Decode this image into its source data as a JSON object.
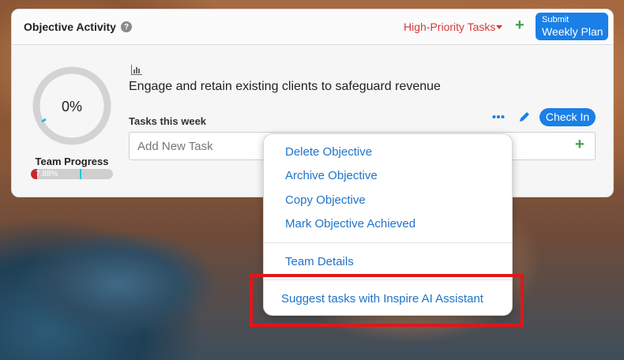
{
  "header": {
    "title": "Objective Activity",
    "help_icon": "?",
    "priority_filter": "High-Priority Tasks",
    "submit_small": "Submit",
    "submit_big": "Weekly Plan",
    "plus": "+"
  },
  "progress": {
    "percent_text": "0%",
    "percent_value": 0,
    "label": "Team Progress",
    "team_bar_text": "7.88%",
    "team_bar_value": 7.88
  },
  "objective": {
    "title": "Engage and retain existing clients to safeguard revenue",
    "tasks_label": "Tasks this week",
    "checkin_label": "Check In",
    "add_task_placeholder": "Add New Task",
    "add_plus": "+"
  },
  "menu": {
    "items": [
      "Delete Objective",
      "Archive Objective",
      "Copy Objective",
      "Mark Objective Achieved"
    ],
    "team_details": "Team Details",
    "ai_suggest": "Suggest tasks with Inspire AI Assistant"
  },
  "colors": {
    "accent": "#1a7fe6",
    "priority": "#d9383a",
    "plus_green": "#43a047",
    "highlight": "#e0161b",
    "menu_text": "#1f73c9"
  }
}
